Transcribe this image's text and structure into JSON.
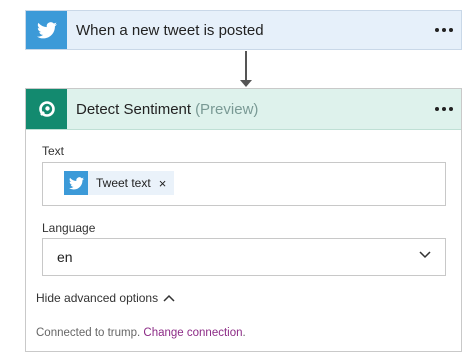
{
  "trigger": {
    "title": "When a new tweet is posted",
    "icon": "twitter-icon",
    "accent": "#3c9ad8"
  },
  "action": {
    "title": "Detect Sentiment",
    "subtitle": "(Preview)",
    "icon": "cognitive-services-icon",
    "accent": "#138a6f",
    "text_field": {
      "label": "Text",
      "token": {
        "label": "Tweet text",
        "remove": "×",
        "icon": "twitter-icon"
      }
    },
    "language_field": {
      "label": "Language",
      "value": "en"
    },
    "advanced_toggle": "Hide advanced options",
    "connection": {
      "prefix": "Connected to trump.",
      "link": "Change connection",
      "suffix": "."
    }
  }
}
